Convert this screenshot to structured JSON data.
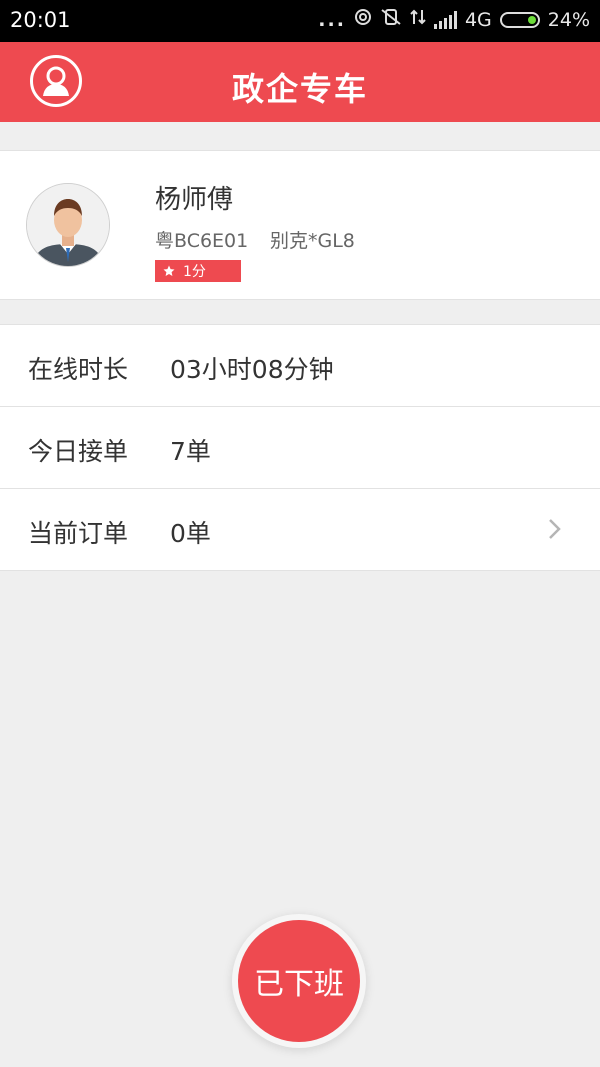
{
  "status_bar": {
    "time": "20:01",
    "dots": "...",
    "network": "4G",
    "battery": "24%"
  },
  "header": {
    "title": "政企专车",
    "accent_color": "#ee4a50"
  },
  "driver": {
    "name": "杨师傅",
    "plate": "粤BC6E01",
    "car": "别克*GL8",
    "rating": "1分"
  },
  "stats": [
    {
      "label": "在线时长",
      "value": "03小时08分钟"
    },
    {
      "label": "今日接单",
      "value": "7单"
    },
    {
      "label": "当前订单",
      "value": "0单"
    }
  ],
  "action": {
    "label": "已下班"
  }
}
